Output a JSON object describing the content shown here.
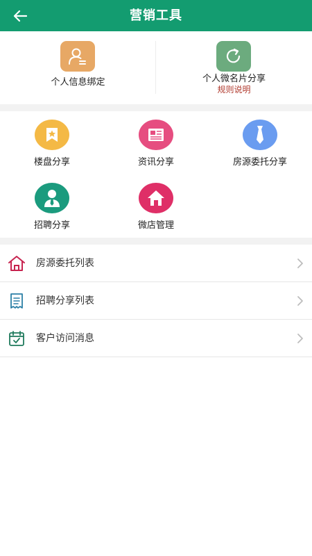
{
  "header": {
    "title": "营销工具"
  },
  "top": [
    {
      "label": "个人信息绑定",
      "icon": "person-card-icon",
      "color": "#e7a865"
    },
    {
      "label": "个人微名片分享",
      "sub": "规则说明",
      "icon": "share-refresh-icon",
      "color": "#6cab7e"
    }
  ],
  "grid": [
    {
      "label": "楼盘分享",
      "icon": "star-bookmark-icon",
      "color": "#f4b945"
    },
    {
      "label": "资讯分享",
      "icon": "newspaper-icon",
      "color": "#e64d80"
    },
    {
      "label": "房源委托分享",
      "icon": "necktie-icon",
      "color": "#6a9cf0"
    },
    {
      "label": "招聘分享",
      "icon": "person-tie-icon",
      "color": "#1b9b7e"
    },
    {
      "label": "微店管理",
      "icon": "house-icon",
      "color": "#df2f67"
    }
  ],
  "list": [
    {
      "label": "房源委托列表",
      "icon": "house-outline-icon"
    },
    {
      "label": "招聘分享列表",
      "icon": "document-list-icon"
    },
    {
      "label": "客户访问消息",
      "icon": "calendar-check-icon"
    }
  ],
  "colors": {
    "header": "#139c70",
    "accent_text": "#b03a2e",
    "background_gap": "#f2f2f2"
  }
}
